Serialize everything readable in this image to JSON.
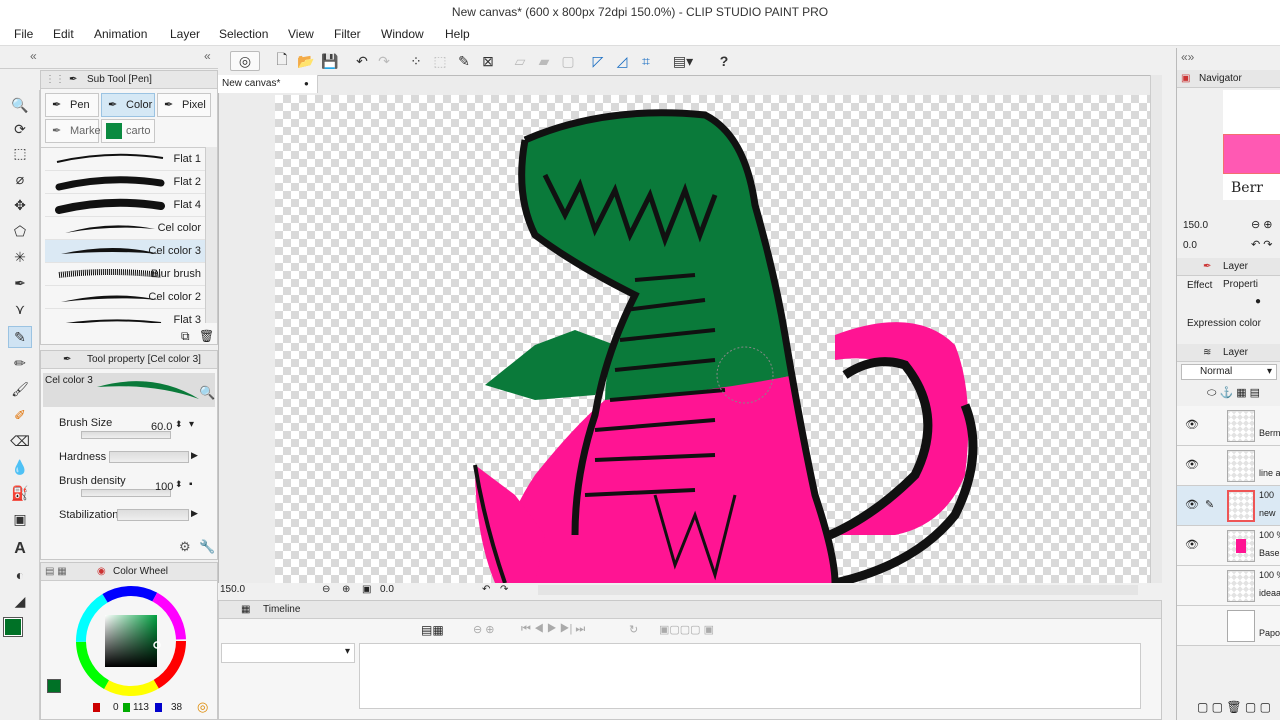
{
  "window": {
    "title": "New canvas* (600 x 800px 72dpi 150.0%) - CLIP STUDIO PAINT PRO"
  },
  "menu": [
    "File",
    "Edit",
    "Animation",
    "Layer",
    "Selection",
    "View",
    "Filter",
    "Window",
    "Help"
  ],
  "canvas": {
    "tab": "New canvas*",
    "zoom": "150.0",
    "angle": "0.0"
  },
  "subtool": {
    "title": "Sub Tool [Pen]",
    "tabs": {
      "pen": "Pen",
      "color": "Color",
      "pixel": "Pixel",
      "marker": "Marke",
      "cartoon": "carto"
    },
    "brushes": [
      "Flat 1",
      "Flat 2",
      "Flat 4",
      "Cel color",
      "Cel color 3",
      "Blur brush",
      "Cel color 2",
      "Flat 3"
    ],
    "selected": "Cel color 3"
  },
  "tool_property": {
    "title": "Tool property [Cel color 3]",
    "preview_label": "Cel color 3",
    "brush_size_label": "Brush Size",
    "brush_size": "60.0",
    "hardness_label": "Hardness",
    "density_label": "Brush density",
    "density": "100",
    "stabilization_label": "Stabilization"
  },
  "color": {
    "title": "Color Wheel",
    "r": "0",
    "g": "113",
    "b": "38",
    "main": "#007126",
    "sub": "#000000"
  },
  "timeline": {
    "title": "Timeline"
  },
  "navigator": {
    "title": "Navigator",
    "zoom": "150.0",
    "angle": "0.0"
  },
  "layer_property": {
    "title": "Layer Properti",
    "effect": "Effect",
    "expression": "Expression color"
  },
  "layers": {
    "title": "Layer",
    "blend": "Normal",
    "items": [
      {
        "line1": "",
        "line2": "Berm"
      },
      {
        "line1": "",
        "line2": "line a"
      },
      {
        "line1": "100",
        "line2": "new"
      },
      {
        "line1": "100 %",
        "line2": "Base"
      },
      {
        "line1": "100 %",
        "line2": "ideaa"
      },
      {
        "line1": "",
        "line2": "Papo"
      }
    ]
  },
  "accent": {
    "selection": "#dbe9f4",
    "dino_green": "#0a7a3a",
    "dino_pink": "#ff1493"
  }
}
